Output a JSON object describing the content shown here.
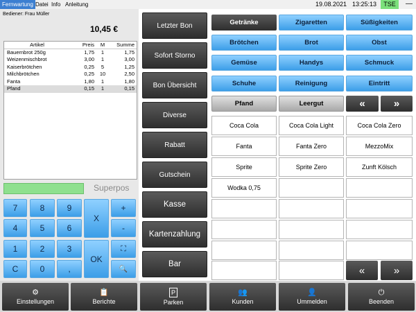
{
  "menu": {
    "items": [
      "Fernwartung",
      "Datei",
      "Info",
      "Anleitung"
    ],
    "date": "19.08.2021",
    "time": "13:25:13",
    "tse": "TSE",
    "minimize": "—"
  },
  "left": {
    "waiter_label": "Bediener:  Frau Müller",
    "total": "10,45 €",
    "brand": "Superpos",
    "receipt": {
      "headers": [
        "Artikel",
        "Preis",
        "M",
        "Summe"
      ],
      "rows": [
        [
          "Bauernbrot 250g",
          "1,75",
          "1",
          "1,75"
        ],
        [
          "Weizenmischbrot",
          "3,00",
          "1",
          "3,00"
        ],
        [
          "Kaiserbrötchen",
          "0,25",
          "5",
          "1,25"
        ],
        [
          "Milchbrötchen",
          "0,25",
          "10",
          "2,50"
        ],
        [
          "Fanta",
          "1,80",
          "1",
          "1,80"
        ],
        [
          "Pfand",
          "0,15",
          "1",
          "0,15"
        ]
      ]
    },
    "keypad": {
      "k7": "7",
      "k8": "8",
      "k9": "9",
      "k4": "4",
      "k5": "5",
      "k6": "6",
      "k1": "1",
      "k2": "2",
      "k3": "3",
      "kc": "C",
      "k0": "0",
      "kcomma": ",",
      "kx": "X",
      "kok": "OK",
      "kplus": "+",
      "kminus": "-",
      "kscan": "⛶",
      "ksearch": "🔍"
    }
  },
  "functions": [
    "Letzter Bon",
    "Sofort Storno",
    "Bon Übersicht",
    "Diverse",
    "Rabatt",
    "Gutschein",
    "Kasse",
    "Kartenzahlung",
    "Bar"
  ],
  "categories": {
    "row1": [
      "Getränke",
      "Zigaretten",
      "Süßigkeiten"
    ],
    "row2": [
      "Brötchen",
      "Brot",
      "Obst"
    ],
    "row3": [
      "Gemüse",
      "Handys",
      "Schmuck"
    ],
    "row4": [
      "Schuhe",
      "Reinigung",
      "Eintritt"
    ],
    "row5": [
      "Pfand",
      "Leergut",
      "«",
      "»"
    ]
  },
  "products": [
    "Coca Cola",
    "Coca Cola Light",
    "Coca Cola Zero",
    "Fanta",
    "Fanta Zero",
    "MezzoMix",
    "Sprite",
    "Sprite Zero",
    "Zunft Kölsch",
    "Wodka 0,75"
  ],
  "pager": {
    "prev": "«",
    "next": "»"
  },
  "bottom": {
    "items": [
      {
        "icon": "⚙",
        "label": "Einstellungen"
      },
      {
        "icon": "📋",
        "label": "Berichte"
      },
      {
        "icon": "P",
        "label": "Parken"
      },
      {
        "icon": "👥",
        "label": "Kunden"
      },
      {
        "icon": "👤",
        "label": "Ummelden"
      },
      {
        "icon": "⏻",
        "label": "Beenden"
      }
    ]
  },
  "colors": {
    "accent_blue": "#3c9ee8",
    "dark_button": "#2e2e2e",
    "tse_green": "#7be07b",
    "input_green": "#8ee08e",
    "menu_active": "#3c7fd1"
  }
}
